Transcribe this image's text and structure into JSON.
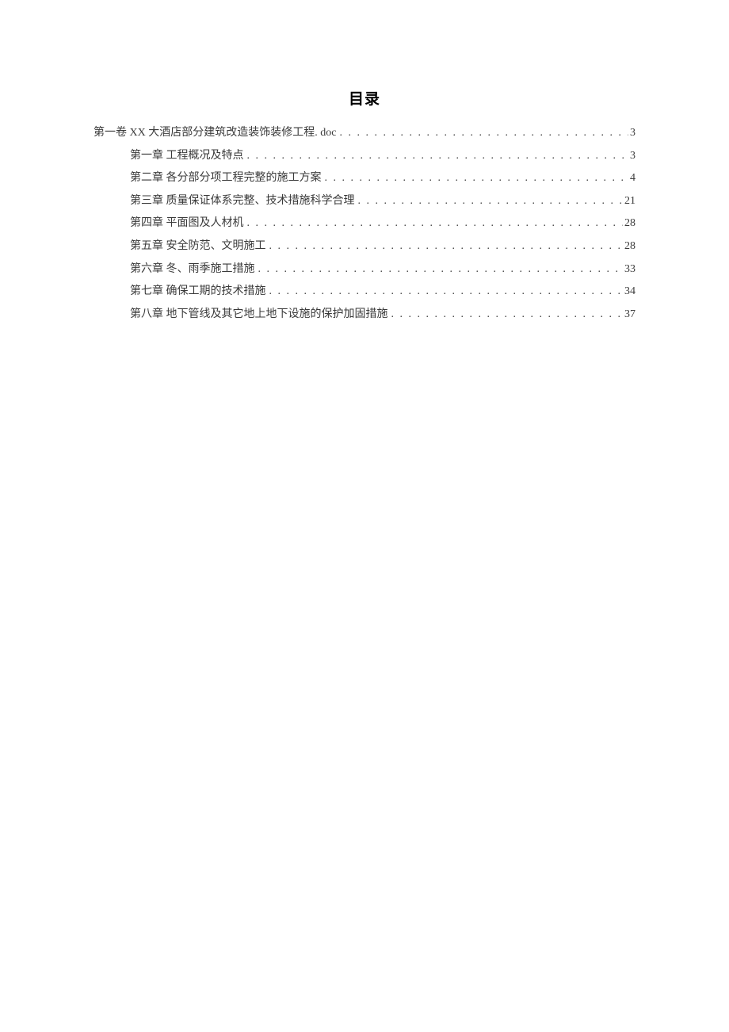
{
  "title": "目录",
  "toc": [
    {
      "level": 0,
      "label": "第一卷 XX 大酒店部分建筑改造装饰装修工程. doc",
      "page": "3"
    },
    {
      "level": 1,
      "label": "第一章 工程概况及特点",
      "page": "3"
    },
    {
      "level": 1,
      "label": "第二章 各分部分项工程完整的施工方案",
      "page": "4"
    },
    {
      "level": 1,
      "label": "第三章 质量保证体系完整、技术措施科学合理",
      "page": "21"
    },
    {
      "level": 1,
      "label": "第四章 平面图及人材机",
      "page": "28"
    },
    {
      "level": 1,
      "label": "第五章 安全防范、文明施工",
      "page": "28"
    },
    {
      "level": 1,
      "label": "第六章 冬、雨季施工措施",
      "page": "33"
    },
    {
      "level": 1,
      "label": "第七章 确保工期的技术措施",
      "page": "34"
    },
    {
      "level": 1,
      "label": "第八章 地下管线及其它地上地下设施的保护加固措施",
      "page": "37"
    }
  ]
}
